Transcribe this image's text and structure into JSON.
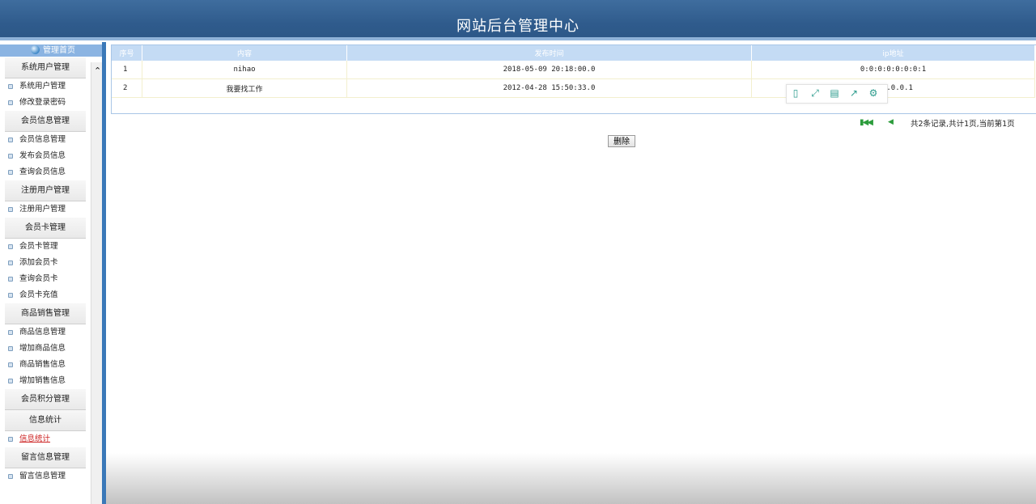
{
  "header": {
    "title": "网站后台管理中心"
  },
  "sidebar": {
    "home_label": "管理首页",
    "sections": [
      {
        "title": "系统用户管理",
        "items": [
          "系统用户管理",
          "修改登录密码"
        ]
      },
      {
        "title": "会员信息管理",
        "items": [
          "会员信息管理",
          "发布会员信息",
          "查询会员信息"
        ]
      },
      {
        "title": "注册用户管理",
        "items": [
          "注册用户管理"
        ]
      },
      {
        "title": "会员卡管理",
        "items": [
          "会员卡管理",
          "添加会员卡",
          "查询会员卡",
          "会员卡充值"
        ]
      },
      {
        "title": "商品销售管理",
        "items": [
          "商品信息管理",
          "增加商品信息",
          "商品销售信息",
          "增加销售信息"
        ]
      },
      {
        "title": "会员积分管理",
        "items": []
      },
      {
        "title": "信息统计",
        "items": [
          "信息统计"
        ]
      },
      {
        "title": "留言信息管理",
        "items": [
          "留言信息管理"
        ]
      }
    ]
  },
  "table": {
    "headers": [
      "序号",
      "内容",
      "发布时间",
      "ip地址"
    ],
    "rows": [
      [
        "1",
        "nihao",
        "2018-05-09 20:18:00.0",
        "0:0:0:0:0:0:0:1"
      ],
      [
        "2",
        "我要找工作",
        "2012-04-28 15:50:33.0",
        "127.0.0.1"
      ]
    ]
  },
  "pager": {
    "info": "共2条记录,共计1页,当前第1页"
  },
  "actions": {
    "delete_label": "删除"
  },
  "icons": {
    "first": "first-page-icon",
    "prev": "prev-page-icon"
  }
}
